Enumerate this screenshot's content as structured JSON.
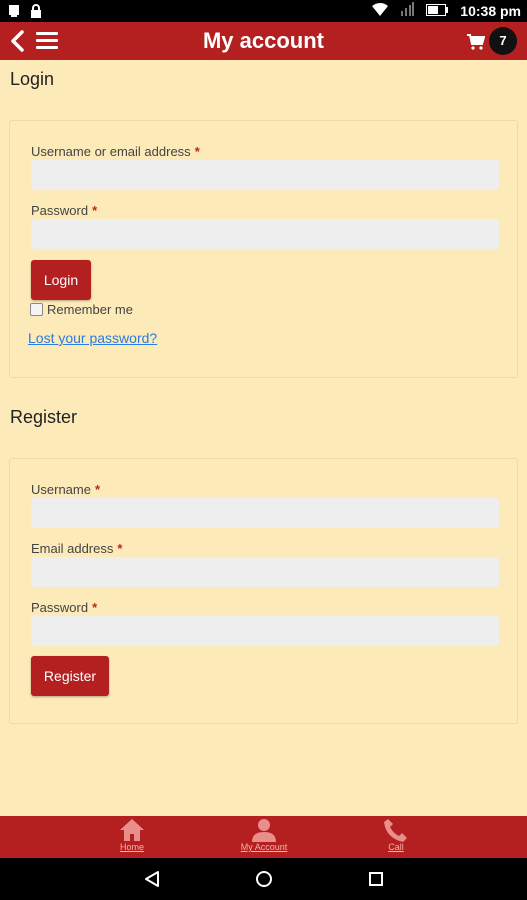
{
  "status_bar": {
    "time": "10:38 pm",
    "icons": [
      "notification-icon",
      "lock-icon",
      "wifi-icon",
      "signal-icon",
      "battery-icon"
    ]
  },
  "app_bar": {
    "title": "My account",
    "cart_count": "7",
    "icons": [
      "back-arrow-icon",
      "menu-icon",
      "cart-icon"
    ]
  },
  "login": {
    "title": "Login",
    "username_label": "Username or email address",
    "password_label": "Password",
    "required_mark": "*",
    "login_button": "Login",
    "remember_me": "Remember me",
    "lost_password": "Lost your password?"
  },
  "register": {
    "title": "Register",
    "username_label": "Username",
    "email_label": "Email address",
    "password_label": "Password",
    "required_mark": "*",
    "register_button": "Register"
  },
  "bottom_nav": {
    "items": [
      {
        "label": "Home",
        "icon": "home-icon"
      },
      {
        "label": "My Account",
        "icon": "user-icon"
      },
      {
        "label": "Call",
        "icon": "phone-icon"
      }
    ]
  },
  "system_nav": {
    "icons": [
      "back-triangle-icon",
      "home-circle-icon",
      "recents-square-icon"
    ]
  },
  "colors": {
    "primary": "#b3201f",
    "background": "#fdeab9",
    "field": "#eeeeee",
    "link": "#2b7be0"
  }
}
